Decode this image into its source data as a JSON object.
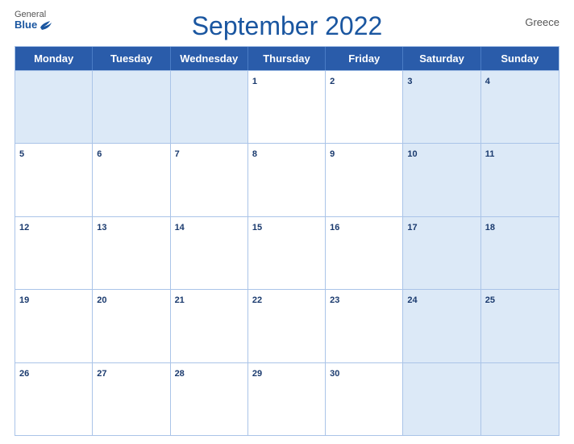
{
  "header": {
    "title": "September 2022",
    "country": "Greece",
    "logo": {
      "general": "General",
      "blue": "Blue"
    }
  },
  "days_of_week": [
    "Monday",
    "Tuesday",
    "Wednesday",
    "Thursday",
    "Friday",
    "Saturday",
    "Sunday"
  ],
  "weeks": [
    [
      {
        "day": "",
        "shaded": true
      },
      {
        "day": "",
        "shaded": true
      },
      {
        "day": "",
        "shaded": true
      },
      {
        "day": "1",
        "shaded": false
      },
      {
        "day": "2",
        "shaded": false
      },
      {
        "day": "3",
        "shaded": true
      },
      {
        "day": "4",
        "shaded": true
      }
    ],
    [
      {
        "day": "5",
        "shaded": false
      },
      {
        "day": "6",
        "shaded": false
      },
      {
        "day": "7",
        "shaded": false
      },
      {
        "day": "8",
        "shaded": false
      },
      {
        "day": "9",
        "shaded": false
      },
      {
        "day": "10",
        "shaded": true
      },
      {
        "day": "11",
        "shaded": true
      }
    ],
    [
      {
        "day": "12",
        "shaded": false
      },
      {
        "day": "13",
        "shaded": false
      },
      {
        "day": "14",
        "shaded": false
      },
      {
        "day": "15",
        "shaded": false
      },
      {
        "day": "16",
        "shaded": false
      },
      {
        "day": "17",
        "shaded": true
      },
      {
        "day": "18",
        "shaded": true
      }
    ],
    [
      {
        "day": "19",
        "shaded": false
      },
      {
        "day": "20",
        "shaded": false
      },
      {
        "day": "21",
        "shaded": false
      },
      {
        "day": "22",
        "shaded": false
      },
      {
        "day": "23",
        "shaded": false
      },
      {
        "day": "24",
        "shaded": true
      },
      {
        "day": "25",
        "shaded": true
      }
    ],
    [
      {
        "day": "26",
        "shaded": false
      },
      {
        "day": "27",
        "shaded": false
      },
      {
        "day": "28",
        "shaded": false
      },
      {
        "day": "29",
        "shaded": false
      },
      {
        "day": "30",
        "shaded": false
      },
      {
        "day": "",
        "shaded": true
      },
      {
        "day": "",
        "shaded": true
      }
    ]
  ]
}
